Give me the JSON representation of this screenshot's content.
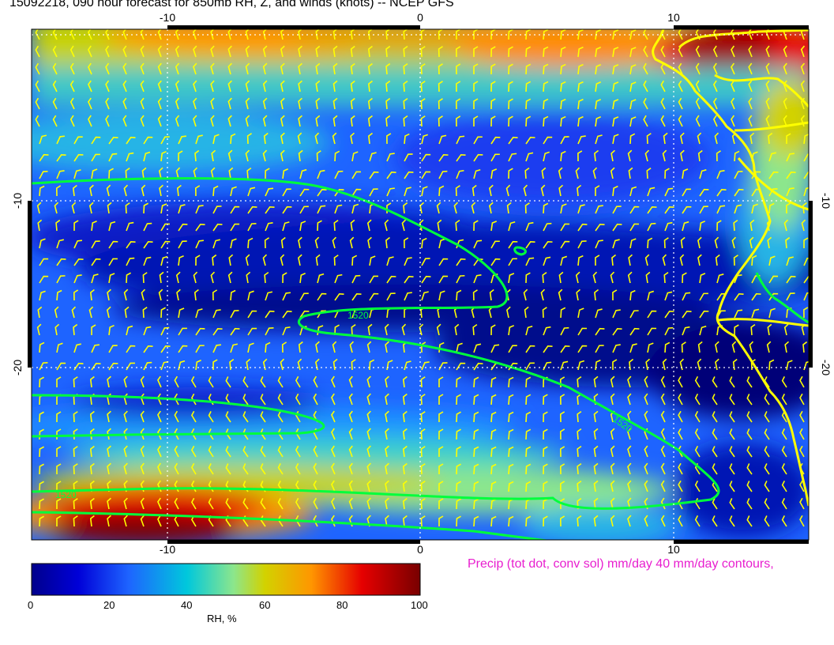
{
  "title": "15092218, 090 hour forecast for 850mb RH, Z, and winds (knots)  -- NCEP GFS",
  "map": {
    "x_ticks": [
      "-10",
      "0",
      "10"
    ],
    "y_ticks": [
      "-10",
      "-20"
    ],
    "contour_labels": [
      "1520",
      "1520",
      "1520"
    ]
  },
  "colorbar": {
    "ticks": [
      "0",
      "20",
      "40",
      "60",
      "80",
      "100"
    ],
    "label": "RH, %"
  },
  "precip_note": "Precip (tot dot, conv sol) mm/day 40 mm/day contours,",
  "colors": {
    "rh_scale": [
      "#00008c",
      "#0000d8",
      "#1e64ff",
      "#00c8dc",
      "#8ce68c",
      "#d2d200",
      "#ff9600",
      "#e60000",
      "#780000"
    ],
    "wind_barbs": "#ffff00",
    "contours": "#00ff3c",
    "coastline": "#ffff00"
  }
}
